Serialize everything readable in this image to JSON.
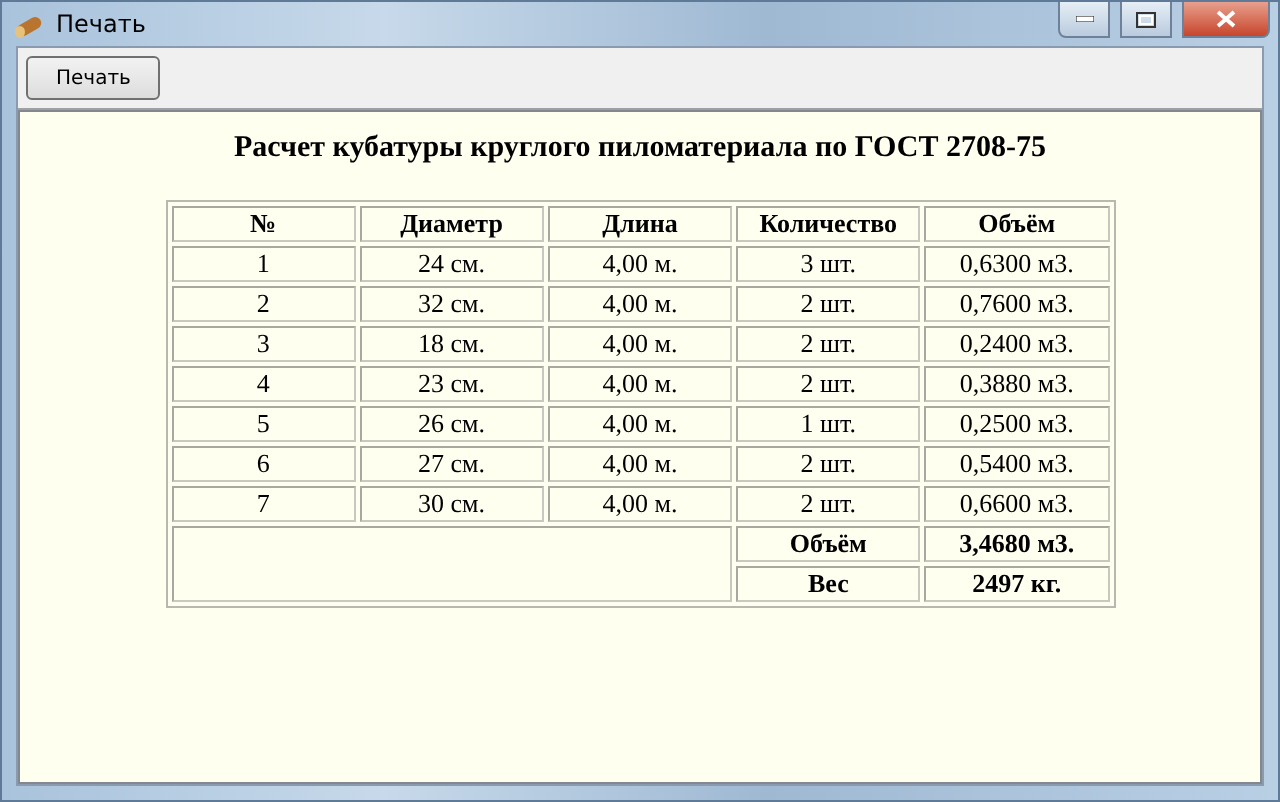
{
  "window": {
    "title": "Печать"
  },
  "toolbar": {
    "buttons": [
      "Печать"
    ]
  },
  "report": {
    "title": "Расчет кубатуры круглого пиломатериала по ГОСТ 2708-75",
    "columns": [
      "№",
      "Диаметр",
      "Длина",
      "Количество",
      "Объём"
    ],
    "rows": [
      [
        "1",
        "24 см.",
        "4,00 м.",
        "3 шт.",
        "0,6300 м3."
      ],
      [
        "2",
        "32 см.",
        "4,00 м.",
        "2 шт.",
        "0,7600 м3."
      ],
      [
        "3",
        "18 см.",
        "4,00 м.",
        "2 шт.",
        "0,2400 м3."
      ],
      [
        "4",
        "23 см.",
        "4,00 м.",
        "2 шт.",
        "0,3880 м3."
      ],
      [
        "5",
        "26 см.",
        "4,00 м.",
        "1 шт.",
        "0,2500 м3."
      ],
      [
        "6",
        "27 см.",
        "4,00 м.",
        "2 шт.",
        "0,5400 м3."
      ],
      [
        "7",
        "30 см.",
        "4,00 м.",
        "2 шт.",
        "0,6600 м3."
      ]
    ],
    "totals": [
      {
        "label": "Объём",
        "value": "3,4680 м3."
      },
      {
        "label": "Вес",
        "value": "2497 кг."
      }
    ]
  }
}
